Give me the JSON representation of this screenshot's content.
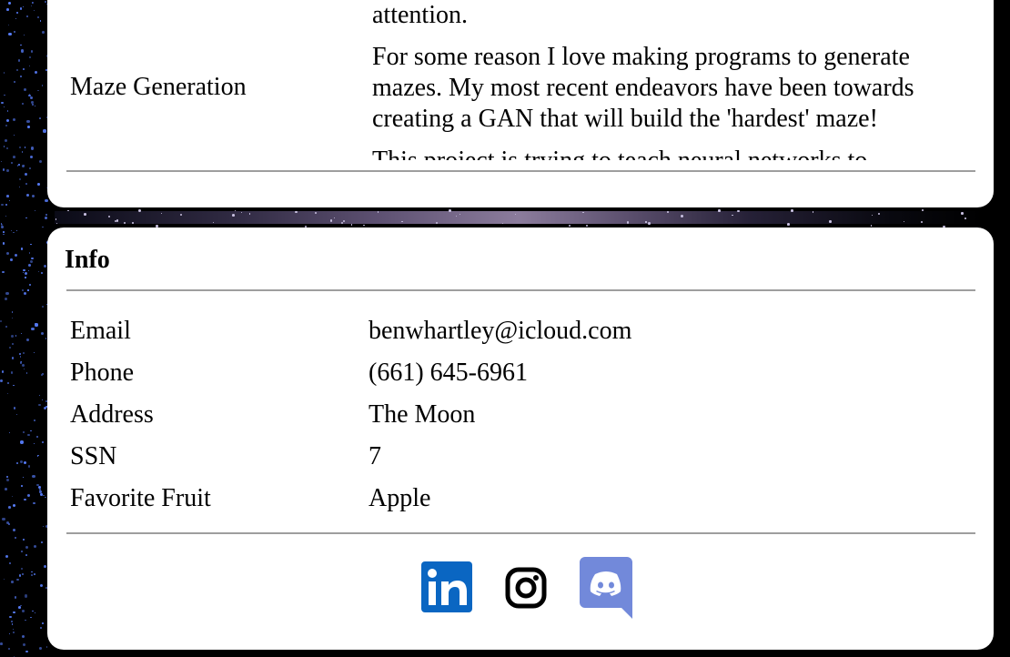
{
  "projects": {
    "fragment_top": "attention.",
    "rows": [
      {
        "name": "Maze Generation",
        "description": "For some reason I love making programs to generate mazes. My most recent endeavors have been towards creating a GAN that will build the 'hardest' maze!"
      },
      {
        "name": "",
        "description": "This project is trying to teach neural networks to"
      }
    ]
  },
  "info": {
    "title": "Info",
    "rows": [
      {
        "label": "Email",
        "value": "benwhartley@icloud.com"
      },
      {
        "label": "Phone",
        "value": "(661) 645-6961"
      },
      {
        "label": "Address",
        "value": "The Moon"
      },
      {
        "label": "SSN",
        "value": "7"
      },
      {
        "label": "Favorite Fruit",
        "value": "Apple"
      }
    ]
  },
  "socials": [
    {
      "name": "linkedin-icon",
      "color": "#0A66C2",
      "text": "in"
    },
    {
      "name": "instagram-icon",
      "color": "#000000"
    },
    {
      "name": "discord-icon",
      "color": "#7289DA"
    }
  ]
}
